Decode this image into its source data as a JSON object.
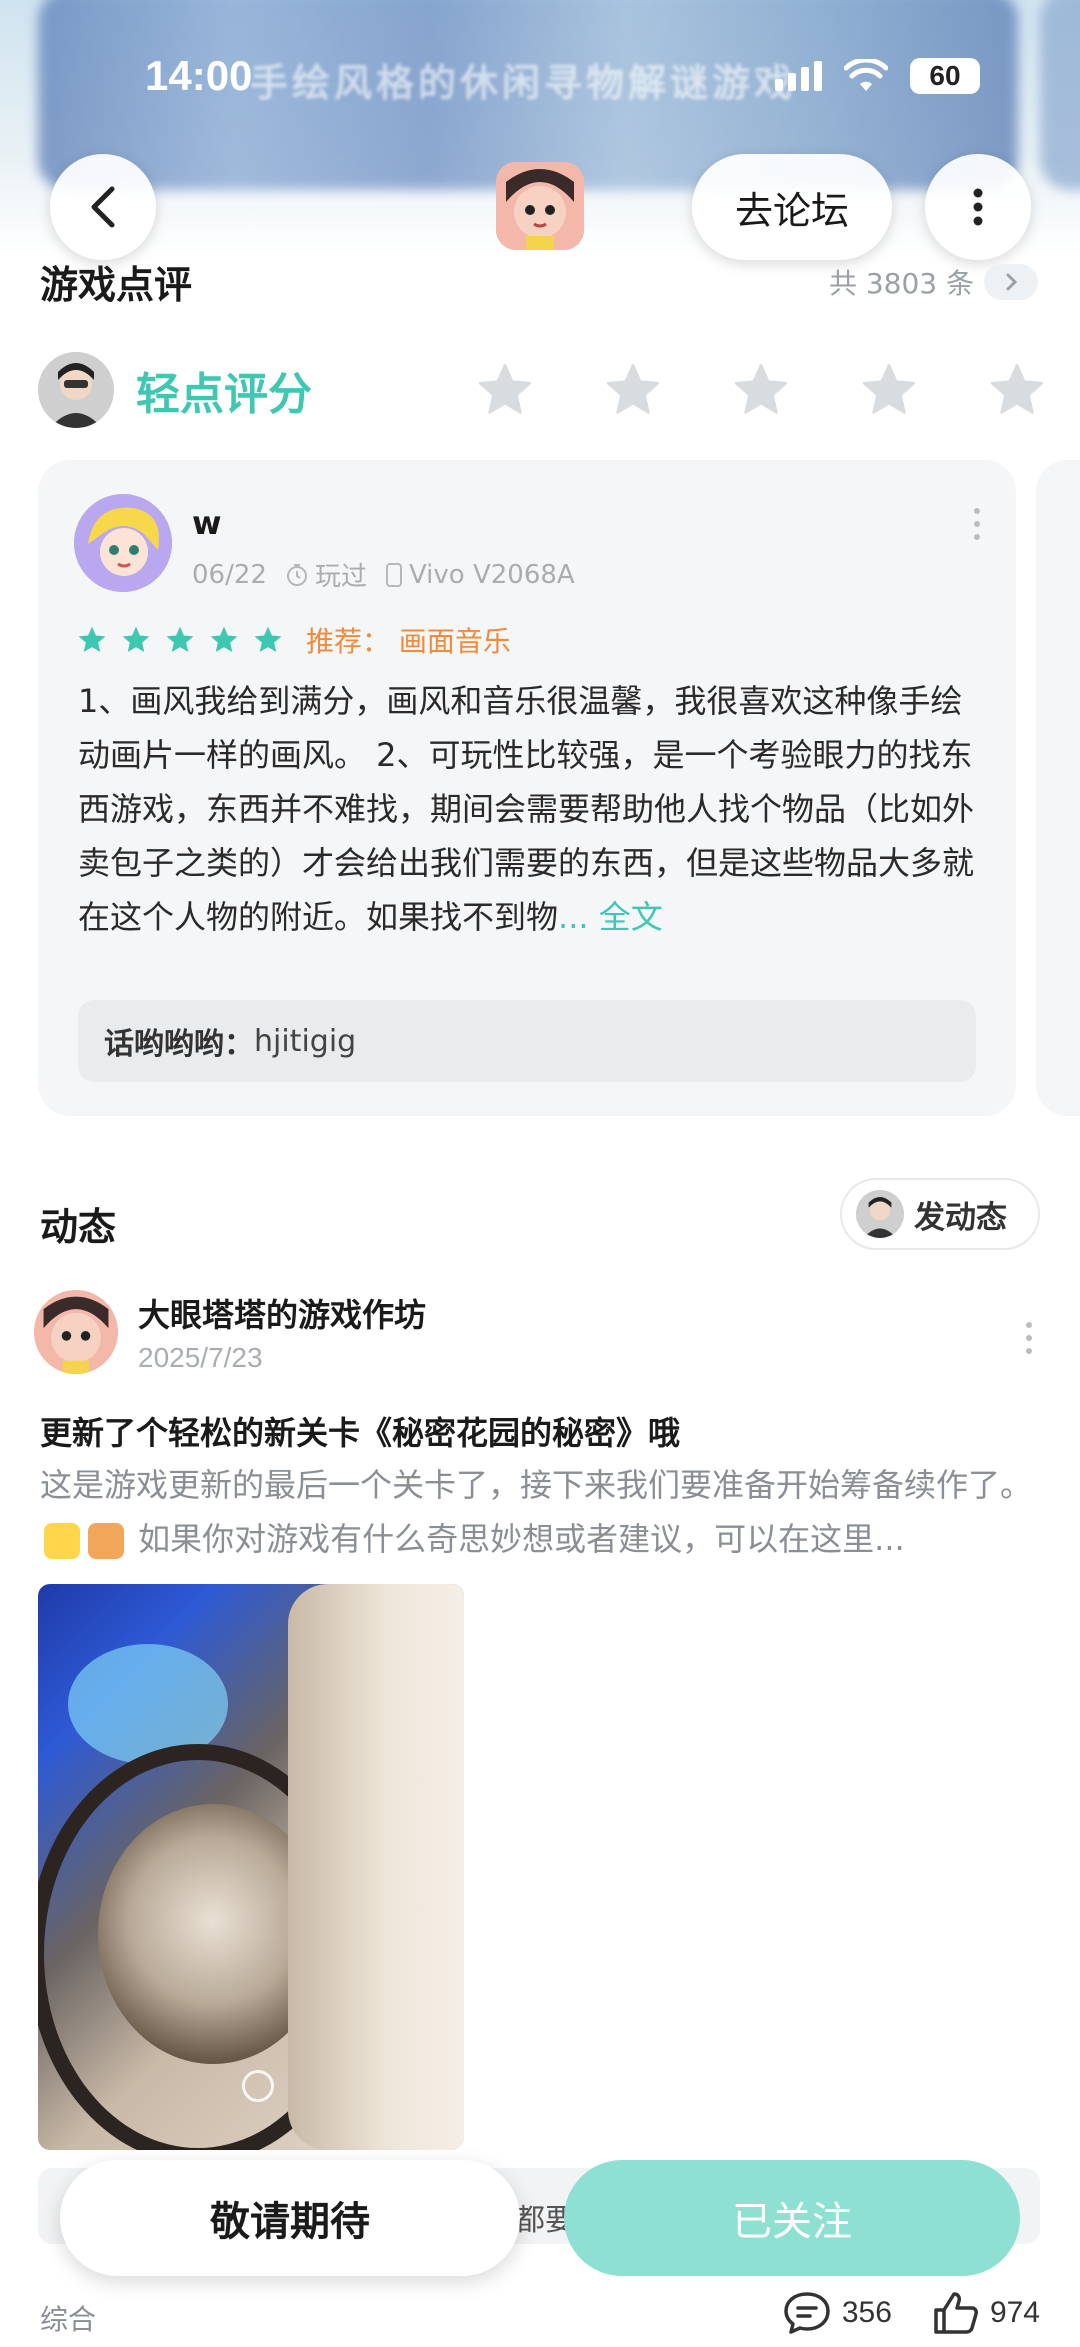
{
  "status": {
    "time": "14:00",
    "battery": "60"
  },
  "banner": {
    "title": "手绘风格的休闲寻物解谜游戏"
  },
  "header": {
    "forum_label": "去论坛"
  },
  "reviews": {
    "section_title": "游戏点评",
    "count_label": "共 3803 条",
    "rate_label": "轻点评分",
    "card": {
      "user": "w",
      "date": "06/22",
      "played": "玩过",
      "device": "Vivo V2068A",
      "rating": 5,
      "recommend": "推荐：  画面音乐",
      "text": "1、画风我给到满分，画风和音乐很温馨，我很喜欢这种像手绘动画片一样的画风。 2、可玩性比较强，是一个考验眼力的找东西游戏，东西并不难找，期间会需要帮助他人找个物品（比如外卖包子之类的）才会给出我们需要的东西，但是这些物品大多就在这个人物的附近。如果找不到物",
      "more": "... 全文",
      "reply_name": "话哟哟哟：",
      "reply_text": "hjitigig"
    }
  },
  "feed": {
    "section_title": "动态",
    "post_button": "发动态",
    "post": {
      "author": "大眼塔塔的游戏作坊",
      "date": "2025/7/23",
      "title": "更新了个轻松的新关卡《秘密花园的秘密》哦",
      "body_1": "这是游戏更新的最后一个关卡了，接下来我们要准备开始筹备续作了。",
      "body_2": " 如果你对游戏有什么奇思妙想或者建议，可以在这里...",
      "strip_text": "都要"
    }
  },
  "bottom": {
    "wait_label": "敬请期待",
    "follow_label": "已关注",
    "tab_label": "综合",
    "comments": "356",
    "likes": "974"
  },
  "colors": {
    "accent": "#3ec7b1",
    "recommend": "#f08a3c",
    "follow_bg": "#8ee0d2"
  }
}
